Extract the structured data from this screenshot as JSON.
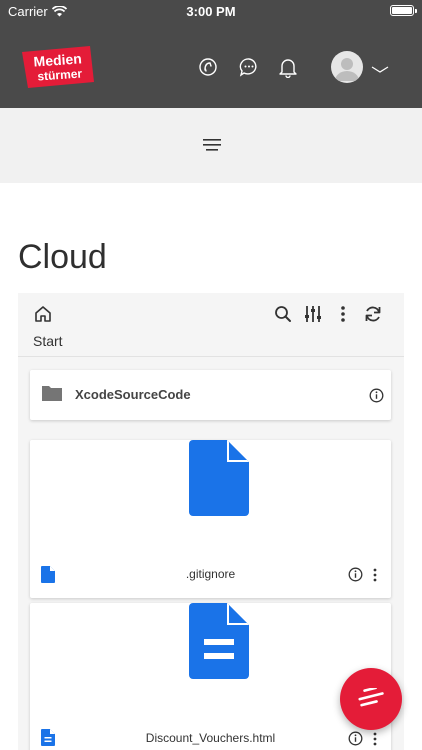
{
  "status_bar": {
    "carrier": "Carrier",
    "time": "3:00 PM"
  },
  "header": {
    "logo_line1": "Medien",
    "logo_line2": "stürmer",
    "brand_color": "#e41c38",
    "icons": [
      "support-icon",
      "chat-icon",
      "notification-bell-icon",
      "avatar",
      "chevron-down-icon"
    ]
  },
  "sub_nav": {
    "icon": "hamburger-menu-icon"
  },
  "page": {
    "title": "Cloud"
  },
  "toolbar": {
    "icons": [
      "home-icon",
      "search-icon",
      "filter-sliders-icon",
      "more-vertical-icon",
      "refresh-icon"
    ],
    "breadcrumb": "Start"
  },
  "items": [
    {
      "type": "folder",
      "name": "XcodeSourceCode"
    },
    {
      "type": "file",
      "name": ".gitignore",
      "icon": "file-icon"
    },
    {
      "type": "file",
      "name": "Discount_Vouchers.html",
      "icon": "document-icon"
    }
  ],
  "accent_color": "#1a73e8"
}
